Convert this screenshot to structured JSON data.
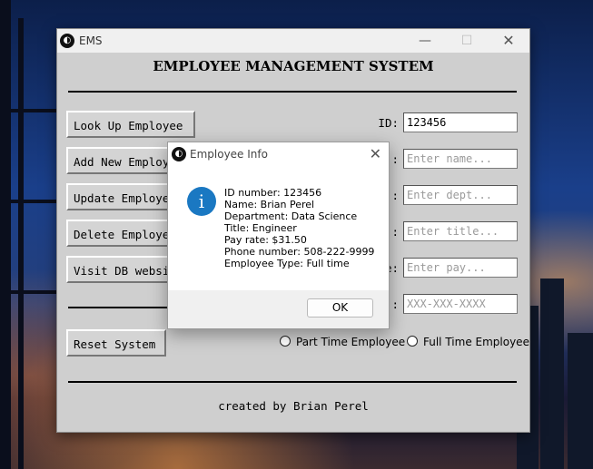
{
  "window": {
    "title": "EMS",
    "icon": "app-logo-icon",
    "minimize_glyph": "—",
    "maximize_glyph": "☐",
    "close_glyph": "✕"
  },
  "heading": "EMPLOYEE MANAGEMENT SYSTEM",
  "buttons": {
    "lookup": "Look Up Employee",
    "add": "Add New Employee",
    "update": "Update Employee",
    "delete": "Delete Employee",
    "visit": "Visit DB website",
    "reset": "Reset System"
  },
  "fields": {
    "id": {
      "label": "ID:",
      "value": "123456"
    },
    "name": {
      "label": ":",
      "placeholder": "Enter name..."
    },
    "dept": {
      "label": ":",
      "placeholder": "Enter dept..."
    },
    "title": {
      "label": ":",
      "placeholder": "Enter title..."
    },
    "pay": {
      "label": "e:",
      "placeholder": "Enter pay..."
    },
    "phone": {
      "label": ":",
      "placeholder": "XXX-XXX-XXXX"
    }
  },
  "radios": {
    "part_time": "Part Time Employee",
    "full_time": "Full Time Employee"
  },
  "credit": "created by Brian Perel",
  "dialog": {
    "title": "Employee Info",
    "close_glyph": "✕",
    "icon": "info-icon",
    "lines": [
      "ID number: 123456",
      "Name: Brian Perel",
      "Department: Data Science",
      "Title: Engineer",
      "Pay rate: $31.50",
      "Phone number: 508-222-9999",
      "Employee Type: Full time"
    ],
    "ok": "OK"
  },
  "colors": {
    "window_bg": "#cfcfcf",
    "info_icon": "#1a78c2"
  }
}
